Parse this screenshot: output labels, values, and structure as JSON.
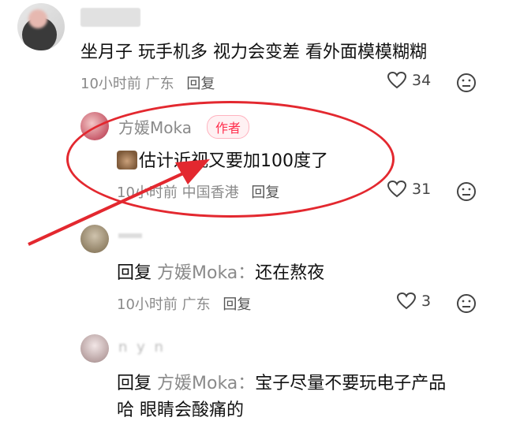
{
  "comments": [
    {
      "text": "坐月子 玩手机多 视力会变差 看外面模模糊糊",
      "time": "10小时前",
      "location": "广东",
      "reply_label": "回复",
      "likes": "34"
    },
    {
      "author": "方媛Moka",
      "badge": "作者",
      "text": "估计近视又要加100度了",
      "time": "10小时前",
      "location": "中国香港",
      "reply_label": "回复",
      "likes": "31"
    },
    {
      "reply_prefix": "回复",
      "reply_target": "方媛Moka：",
      "text": "还在熬夜",
      "time": "10小时前",
      "location": "广东",
      "reply_label": "回复",
      "likes": "3"
    },
    {
      "partial_name": "n   y   n",
      "reply_prefix": "回复",
      "reply_target": "方媛Moka：",
      "text_line1": "宝子尽量不要玩电子产品",
      "text_line2": "哈 眼睛会酸痛的"
    }
  ],
  "colors": {
    "annotation_red": "#e3282f",
    "badge_red": "#ff2e4d"
  },
  "icons": [
    "heart-outline-icon",
    "sad-face-icon",
    "sticker-emoji-icon"
  ]
}
